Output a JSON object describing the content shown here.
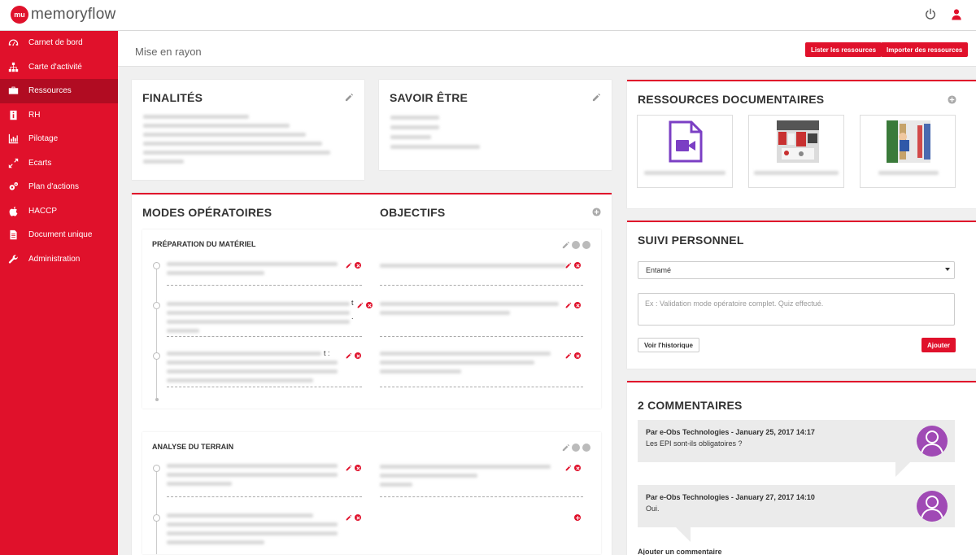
{
  "app": {
    "logo_mark": "mu",
    "logo_text": "memoryflow"
  },
  "topbar": {
    "power_icon": "power-icon",
    "user_icon": "user-icon"
  },
  "sidebar": {
    "items": [
      {
        "label": "Carnet de bord",
        "icon": "dashboard-icon"
      },
      {
        "label": "Carte d'activité",
        "icon": "sitemap-icon"
      },
      {
        "label": "Ressources",
        "icon": "briefcase-icon",
        "active": true
      },
      {
        "label": "RH",
        "icon": "id-card-icon"
      },
      {
        "label": "Pilotage",
        "icon": "bar-chart-icon"
      },
      {
        "label": "Ecarts",
        "icon": "arrows-icon"
      },
      {
        "label": "Plan d'actions",
        "icon": "gears-icon"
      },
      {
        "label": "HACCP",
        "icon": "apple-icon"
      },
      {
        "label": "Document unique",
        "icon": "document-icon"
      },
      {
        "label": "Administration",
        "icon": "wrench-icon"
      }
    ]
  },
  "page": {
    "title": "Mise en rayon",
    "btn_list": "Lister les ressources",
    "btn_import": "Importer des ressources"
  },
  "finalites": {
    "title": "FINALITÉS"
  },
  "savoir_etre": {
    "title": "SAVOIR ÊTRE"
  },
  "modes": {
    "title": "MODES OPÉRATOIRES",
    "objectifs_title": "OBJECTIFS",
    "sections": [
      {
        "title": "PRÉPARATION DU MATÉRIEL",
        "trailing": [
          "t",
          ".",
          "t :"
        ]
      },
      {
        "title": "ANALYSE DU TERRAIN"
      }
    ]
  },
  "ressources": {
    "title": "RESSOURCES DOCUMENTAIRES"
  },
  "suivi": {
    "title": "SUIVI PERSONNEL",
    "select_value": "Entamé",
    "textarea_placeholder": "Ex : Validation mode opératoire complet. Quiz effectué.",
    "btn_history": "Voir l'historique",
    "btn_add": "Ajouter"
  },
  "comments": {
    "title": "2 COMMENTAIRES",
    "items": [
      {
        "author": "Par e-Obs Technologies - January 25, 2017 14:17",
        "text": "Les EPI sont-ils obligatoires ?"
      },
      {
        "author": "Par e-Obs Technologies - January 27, 2017 14:10",
        "text": "Oui."
      }
    ],
    "add_label": "Ajouter un commentaire"
  },
  "colors": {
    "accent": "#e0112b",
    "accent_dark": "#b10c22",
    "avatar": "#a04ab5",
    "video": "#7b3fc4"
  }
}
